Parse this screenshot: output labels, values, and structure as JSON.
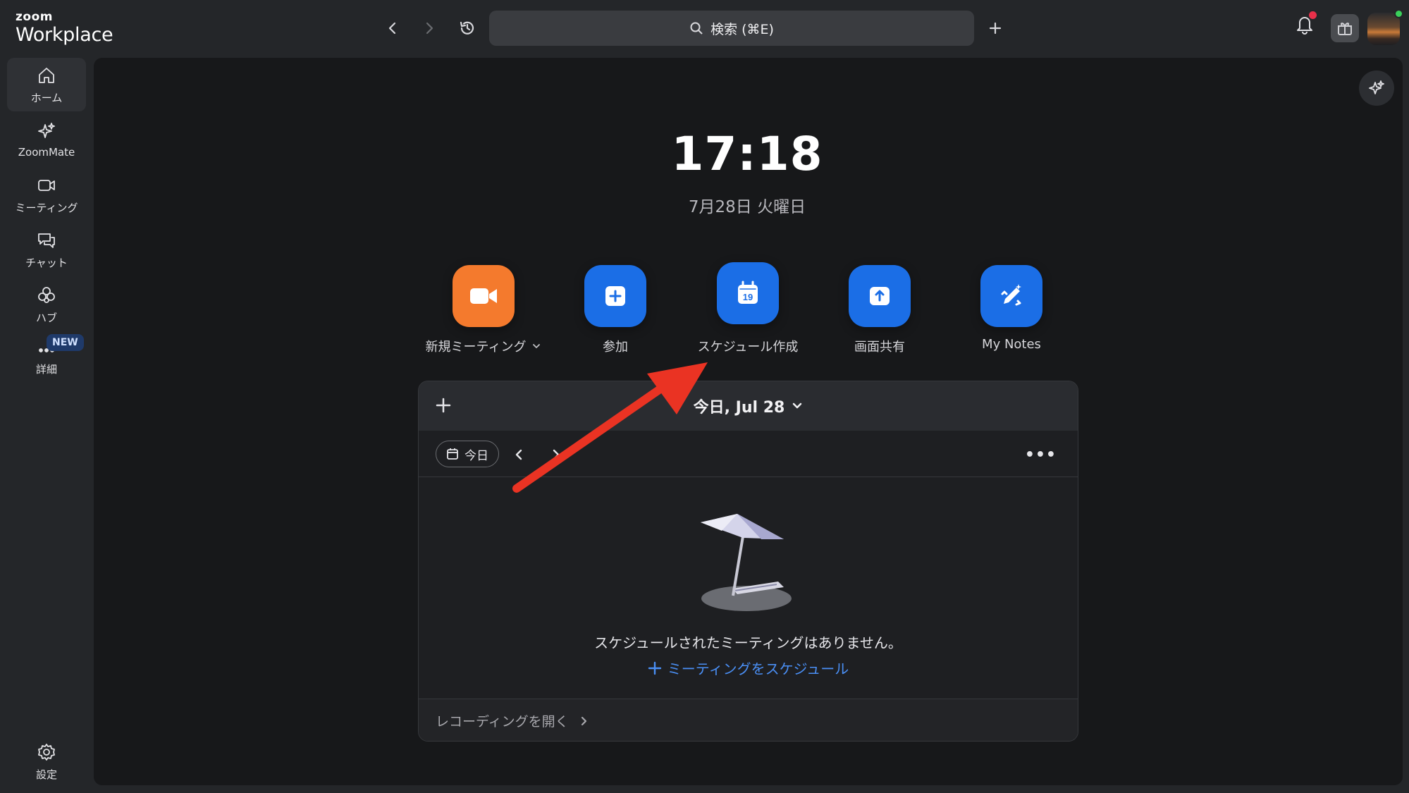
{
  "brand": {
    "line1": "zoom",
    "line2": "Workplace"
  },
  "search": {
    "label": "検索 (⌘E)"
  },
  "sidebar": {
    "items": [
      {
        "label": "ホーム",
        "icon": "home-icon"
      },
      {
        "label": "ZoomMate",
        "icon": "sparkle-icon"
      },
      {
        "label": "ミーティング",
        "icon": "video-icon"
      },
      {
        "label": "チャット",
        "icon": "chat-icon"
      },
      {
        "label": "ハブ",
        "icon": "hub-icon"
      },
      {
        "label": "詳細",
        "icon": "more-icon"
      }
    ],
    "new_badge": "NEW",
    "settings_label": "設定"
  },
  "home": {
    "time": "17:18",
    "date": "7月28日 火曜日",
    "actions": [
      {
        "label": "新規ミーティング",
        "icon": "video-camera-icon"
      },
      {
        "label": "参加",
        "icon": "plus-icon"
      },
      {
        "label": "スケジュール作成",
        "icon": "calendar-icon",
        "day": "19"
      },
      {
        "label": "画面共有",
        "icon": "share-up-icon"
      },
      {
        "label": "My Notes",
        "icon": "pen-notes-icon"
      }
    ]
  },
  "calendar": {
    "title": "今日, Jul 28",
    "today_button": "今日",
    "empty_message": "スケジュールされたミーティングはありません。",
    "schedule_link": "ミーティングをスケジュール",
    "footer_link": "レコーディングを開く"
  },
  "colors": {
    "accent_blue": "#1b6ee6",
    "accent_orange": "#f47a2d",
    "link_blue": "#4a8ff5",
    "arrow_red": "#ea3323"
  }
}
